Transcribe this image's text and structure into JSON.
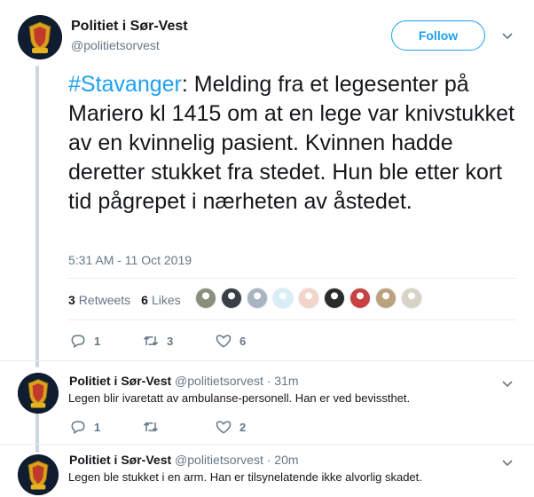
{
  "main_tweet": {
    "author_name": "Politiet i Sør-Vest",
    "author_handle": "@politietsorvest",
    "follow_label": "Follow",
    "hashtag": "#Stavanger",
    "text": ": Melding fra et legesenter på Mariero kl 1415 om at en lege var knivstukket av en kvinnelig pasient. Kvinnen hadde deretter stukket fra stedet. Hun ble etter kort tid pågrepet i nærheten av åstedet.",
    "timestamp": "5:31 AM - 11 Oct 2019",
    "retweets_count": "3",
    "retweets_label": "Retweets",
    "likes_count": "6",
    "likes_label": "Likes",
    "actions": {
      "replies": "1",
      "retweets": "3",
      "likes": "6"
    },
    "liker_colors": [
      "#8a8f7a",
      "#3a3f47",
      "#a9b4c2",
      "#d8eef7",
      "#f2d5c8",
      "#2b2b2b",
      "#c94141",
      "#b9a27c",
      "#d9d3c7"
    ]
  },
  "replies": [
    {
      "author_name": "Politiet i Sør-Vest",
      "author_handle": "@politietsorvest",
      "age": "· 31m",
      "text": "Legen blir ivaretatt av ambulanse-personell. Han er ved bevissthet.",
      "actions": {
        "replies": "1",
        "retweets": "",
        "likes": "2"
      }
    },
    {
      "author_name": "Politiet i Sør-Vest",
      "author_handle": "@politietsorvest",
      "age": "· 20m",
      "text": "Legen ble stukket i en arm. Han er tilsynelatende ikke alvorlig skadet."
    }
  ],
  "colors": {
    "accent": "#1da1f2",
    "muted": "#657786",
    "text": "#14171a"
  },
  "icons": [
    "police-crest-icon",
    "chevron-down-icon",
    "reply-icon",
    "retweet-icon",
    "like-icon"
  ]
}
